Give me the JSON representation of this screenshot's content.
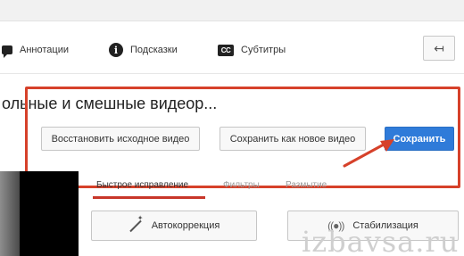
{
  "toolbar": {
    "annotations_label": "Аннотации",
    "tips_label": "Подсказки",
    "subtitles_label": "Субтитры",
    "back_icon": "↤",
    "cc_icon_text": "CC",
    "info_icon_text": "i"
  },
  "video": {
    "title": "ольные и смешные видеор..."
  },
  "actions": {
    "restore_label": "Восстановить исходное видео",
    "save_as_new_label": "Сохранить как новое видео",
    "save_label": "Сохранить"
  },
  "tabs": [
    {
      "label": "Быстрое исправление"
    },
    {
      "label": "Фильтры"
    },
    {
      "label": "Размытие"
    }
  ],
  "tools": {
    "autocorrect_label": "Автокоррекция",
    "stabilize_label": "Стабилизация",
    "stabilize_icon": "((●))"
  },
  "watermark": "izbavsa.ru",
  "colors": {
    "accent": "#2f7bd9",
    "highlight": "#d6412a",
    "tab_underline": "#c8372a"
  }
}
